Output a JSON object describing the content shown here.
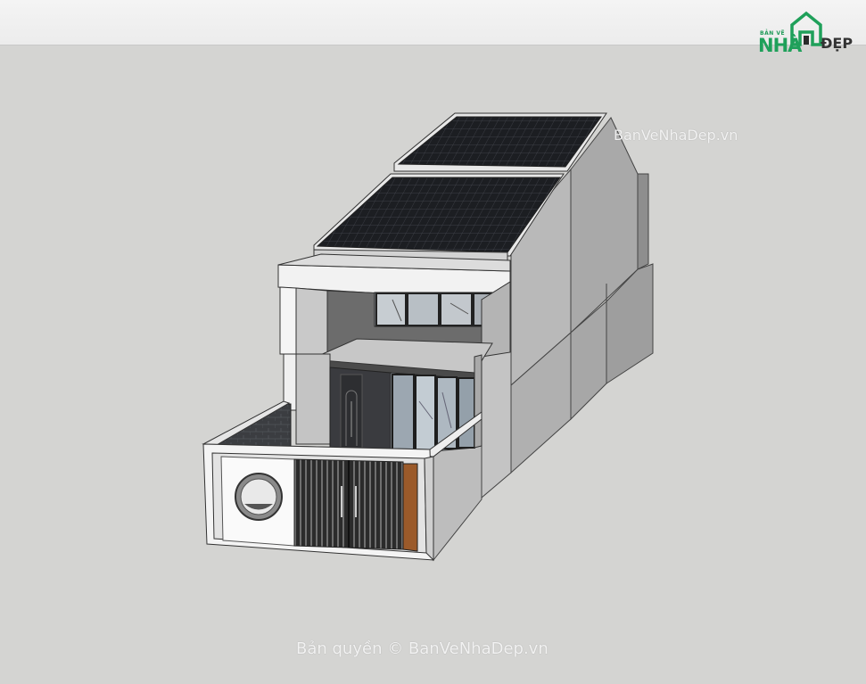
{
  "app": {
    "logo": {
      "small_text": "BẢN VẼ",
      "big_text": "NHÀ",
      "suffix_text": "ĐẸP",
      "icon": "house-icon",
      "brand_color": "#1fa05a"
    }
  },
  "watermarks": {
    "top": "BanVeNhaDep.vn",
    "bottom": "Bản quyền © BanVeNhaDep.vn"
  },
  "viewport": {
    "background_color": "#d4d4d2",
    "model": "two-storey townhouse 3D model"
  }
}
